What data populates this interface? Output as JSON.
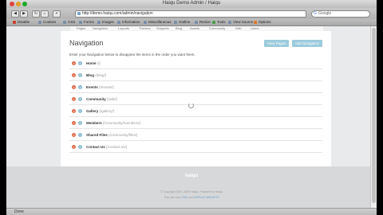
{
  "window": {
    "title": "Haiqu Demo Admin / Haiqu"
  },
  "toolbar": {
    "back": "◀",
    "forward": "▶",
    "reload": "↻",
    "home": "⌂",
    "bookmark": "+",
    "url": "http://demo.haiqu.com/admin/navigation",
    "search_placeholder": "Google"
  },
  "bookmarks": [
    {
      "label": "Disable",
      "color": "#c8402a"
    },
    {
      "label": "Cookies",
      "color": "#7b8ea8"
    },
    {
      "label": "CSS",
      "color": "#7b8ea8"
    },
    {
      "label": "Forms",
      "color": "#7b8ea8"
    },
    {
      "label": "Images",
      "color": "#7b8ea8"
    },
    {
      "label": "Information",
      "color": "#7b8ea8"
    },
    {
      "label": "Miscellaneous",
      "color": "#7b8ea8"
    },
    {
      "label": "Outline",
      "color": "#7b8ea8"
    },
    {
      "label": "Resize",
      "color": "#7b8ea8"
    },
    {
      "label": "Tools",
      "color": "#4aa04a"
    },
    {
      "label": "View Source",
      "color": "#7b8ea8"
    },
    {
      "label": "Options",
      "color": "#7b8ea8"
    }
  ],
  "subnav": [
    "Pages",
    "Navigation",
    "Layouts",
    "Themes",
    "Snippets",
    "Blog",
    "Assets",
    "Community",
    "Wiki",
    "Users"
  ],
  "page": {
    "title": "Navigation",
    "view_pages": "View Pages",
    "add_navigation": "Add Navigation",
    "instructions": "Enter your Navigation below to disappear the items in the order you want them."
  },
  "nav_items": [
    {
      "name": "Home",
      "path": "(/)"
    },
    {
      "name": "Blog",
      "path": "(/blog/)"
    },
    {
      "name": "Events",
      "path": "(/events/)"
    },
    {
      "name": "Community",
      "path": "(/wiki/)"
    },
    {
      "name": "Gallery",
      "path": "(/gallery/)"
    },
    {
      "name": "Members",
      "path": "(/community/members/)"
    },
    {
      "name": "Shared Files",
      "path": "(/community/files/)"
    },
    {
      "name": "Contact Us",
      "path": "(/contact-us/)"
    }
  ],
  "footer": {
    "logo": "haiqu",
    "line1": "© Copyright 2007–2009 Haiqu. Powered by Haiqu",
    "line2a": "This site runs",
    "line2b": "CMS",
    "line2c": "and",
    "line2d": "DISPLAY WIDGETS"
  },
  "status": {
    "text": "Done"
  }
}
